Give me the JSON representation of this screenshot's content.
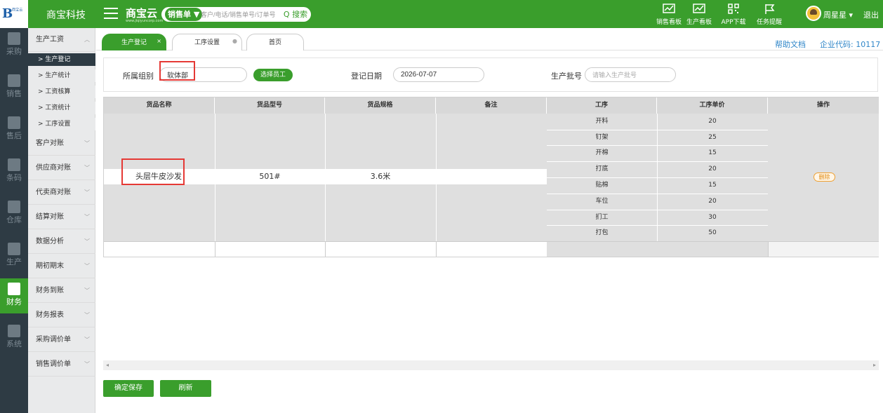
{
  "topbar": {
    "logo_text": "B",
    "logo_small": "商宝云",
    "brand": "商宝科技",
    "app_name": "商宝云",
    "app_site": "www.jiqiyuncorp.com",
    "search_type": "销售单 ▼",
    "search_placeholder": "客户/电话/销售单号/订单号",
    "search_button": "Q 搜索",
    "tools": [
      "销售看板",
      "生产看板",
      "APP下载",
      "任务提醒"
    ],
    "user": "周星星 ▾",
    "logout": "退出"
  },
  "rail": [
    {
      "label": "采购",
      "icon": "cart-icon"
    },
    {
      "label": "销售",
      "icon": "sales-icon"
    },
    {
      "label": "售后",
      "icon": "aftersales-icon"
    },
    {
      "label": "条码",
      "icon": "barcode-icon"
    },
    {
      "label": "仓库",
      "icon": "warehouse-icon"
    },
    {
      "label": "生产",
      "icon": "production-icon"
    },
    {
      "label": "财务",
      "icon": "finance-icon",
      "active": true
    },
    {
      "label": "系统",
      "icon": "gear-icon"
    }
  ],
  "submenu": {
    "group_open": "生产工资",
    "subs": [
      "> 生产登记",
      "> 生产统计",
      "> 工资核算",
      "> 工资统计",
      "> 工序设置"
    ],
    "groups": [
      "客户对账",
      "供应商对账",
      "代卖商对账",
      "结算对账",
      "数据分析",
      "期初期末",
      "财务到账",
      "财务报表",
      "采购调价单",
      "销售调价单"
    ]
  },
  "tabs": [
    {
      "label": "生产登记",
      "close": "×",
      "active": true
    },
    {
      "label": "工序设置",
      "close": "●"
    },
    {
      "label": "首页"
    }
  ],
  "header_links": {
    "help": "帮助文档",
    "corp_code": "企业代码: 10117"
  },
  "form": {
    "group_label": "所属组别",
    "group_value": "软体部",
    "select_staff": "选择员工",
    "date_label": "登记日期",
    "date_value": "2026-07-07",
    "batch_label": "生产批号",
    "batch_placeholder": "请输入生产批号"
  },
  "table": {
    "headers": [
      "货品名称",
      "货品型号",
      "货品规格",
      "备注",
      "工序",
      "工序单价",
      "操作"
    ],
    "product": {
      "name": "头层牛皮沙发",
      "model": "501#",
      "spec": "3.6米",
      "note": ""
    },
    "processes": [
      {
        "name": "开料",
        "price": "20"
      },
      {
        "name": "钉架",
        "price": "25"
      },
      {
        "name": "开棉",
        "price": "15"
      },
      {
        "name": "打底",
        "price": "20"
      },
      {
        "name": "贴棉",
        "price": "15"
      },
      {
        "name": "车位",
        "price": "20"
      },
      {
        "name": "扪工",
        "price": "30"
      },
      {
        "name": "打包",
        "price": "50"
      }
    ],
    "delete": "删除"
  },
  "buttons": {
    "save": "确定保存",
    "refresh": "刷新"
  },
  "colors": {
    "brand_green": "#3a9e2c",
    "rail_dark": "#2e3b44",
    "highlight_red": "#e53935",
    "link_blue": "#2f86c8"
  }
}
